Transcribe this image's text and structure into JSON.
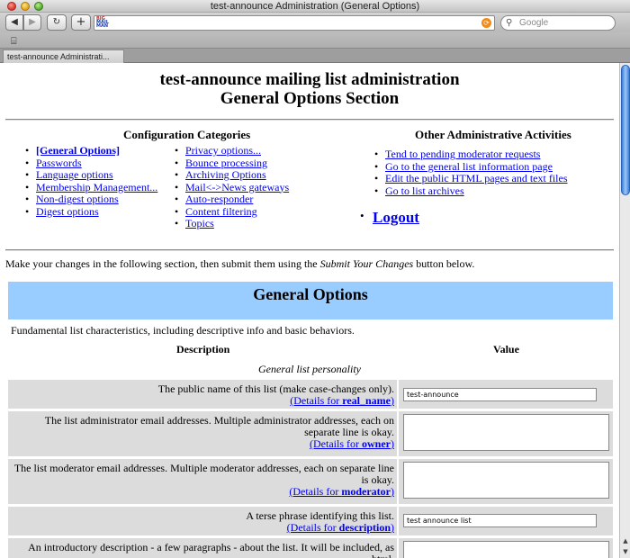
{
  "window": {
    "title": "test-announce Administration (General Options)",
    "tab_label": "test-announce Administrati...",
    "search_placeholder": "Google"
  },
  "header": {
    "line1": "test-announce mailing list administration",
    "line2": "General Options Section"
  },
  "config": {
    "heading": "Configuration Categories",
    "col1": [
      "[General Options]",
      "Passwords",
      "Language options",
      "Membership Management...",
      "Non-digest options",
      "Digest options"
    ],
    "col2": [
      "Privacy options...",
      "Bounce processing",
      "Archiving Options",
      "Mail<->News gateways",
      "Auto-responder",
      "Content filtering",
      "Topics"
    ]
  },
  "other": {
    "heading": "Other Administrative Activities",
    "items": [
      "Tend to pending moderator requests",
      "Go to the general list information page",
      "Edit the public HTML pages and text files",
      "Go to list archives"
    ],
    "logout": "Logout"
  },
  "intro": {
    "before": "Make your changes in the following section, then submit them using the ",
    "emph": "Submit Your Changes",
    "after": " button below."
  },
  "section": {
    "title": "General Options",
    "description": "Fundamental list characteristics, including descriptive info and basic behaviors.",
    "col_description": "Description",
    "col_value": "Value",
    "subsection": "General list personality"
  },
  "rows": [
    {
      "text": "The public name of this list (make case-changes only).",
      "details_prefix": "(Details for ",
      "details_name": "real_name",
      "details_suffix": ")",
      "value": "test-announce"
    },
    {
      "text": "The list administrator email addresses. Multiple administrator addresses, each on separate line is okay.",
      "details_prefix": "(Details for ",
      "details_name": "owner",
      "details_suffix": ")",
      "value": ""
    },
    {
      "text": "The list moderator email addresses. Multiple moderator addresses, each on separate line is okay.",
      "details_prefix": "(Details for ",
      "details_name": "moderator",
      "details_suffix": ")",
      "value": ""
    },
    {
      "text": "A terse phrase identifying this list.",
      "details_prefix": "(Details for ",
      "details_name": "description",
      "details_suffix": ")",
      "value": "test announce list"
    },
    {
      "text": "An introductory description - a few paragraphs - about the list. It will be included, as html,",
      "value": ""
    }
  ]
}
